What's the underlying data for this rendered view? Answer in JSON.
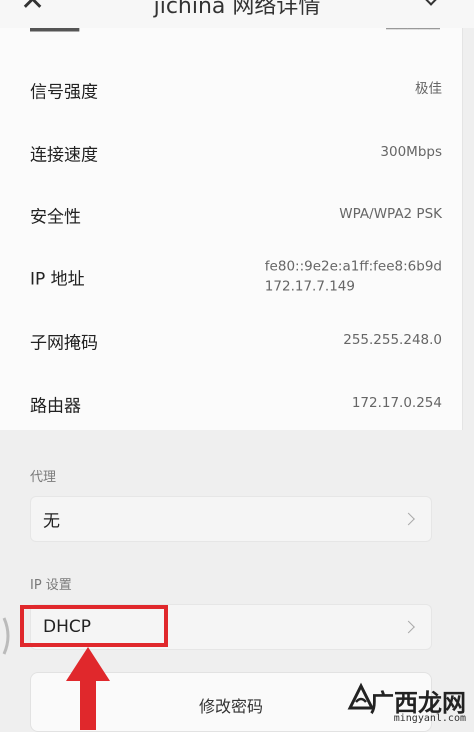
{
  "header": {
    "back_icon": "close-icon",
    "title": "jichina 网络详情",
    "menu_icon": "chevron-down-icon"
  },
  "details": [
    {
      "label": "信号强度",
      "value": "极佳"
    },
    {
      "label": "连接速度",
      "value": "300Mbps"
    },
    {
      "label": "安全性",
      "value": "WPA/WPA2 PSK"
    },
    {
      "label": "IP 地址",
      "value": "fe80::9e2e:a1ff:fee8:6b9d\n172.17.7.149"
    },
    {
      "label": "子网掩码",
      "value": "255.255.248.0"
    },
    {
      "label": "路由器",
      "value": "172.17.0.254"
    }
  ],
  "proxy": {
    "section_label": "代理",
    "value": "无"
  },
  "ip_settings": {
    "section_label": "IP 设置",
    "value": "DHCP"
  },
  "modify_password_button": "修改密码",
  "annotation": {
    "color": "#e0282c"
  },
  "watermark": {
    "text": "广西龙网",
    "sub": "mingyanl.com"
  }
}
